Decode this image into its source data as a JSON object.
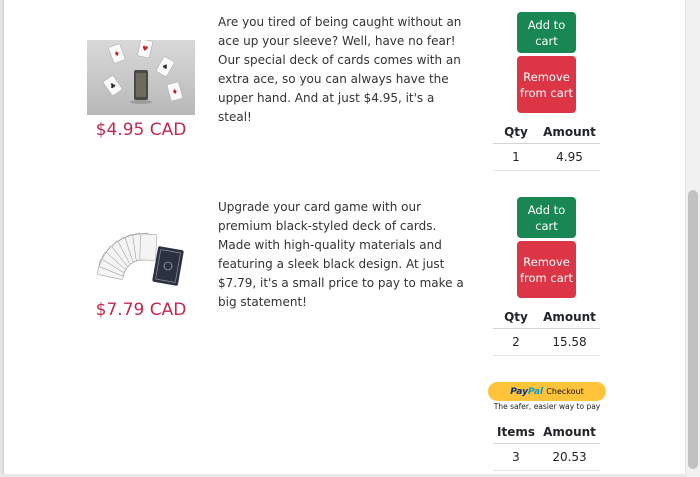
{
  "products": [
    {
      "description": "Are you tired of being caught without an ace up your sleeve? Well, have no fear! Our special deck of cards comes with an extra ace, so you can always have the upper hand. And at just $4.95, it's a steal!",
      "price": "$4.95 CAD",
      "add_label": "Add to cart",
      "remove_label": "Remove from cart",
      "qty_header": "Qty",
      "amount_header": "Amount",
      "qty": "1",
      "amount": "4.95"
    },
    {
      "description": "Upgrade your card game with our premium black-styled deck of cards. Made with high-quality materials and featuring a sleek black design. At just $7.79, it's a small price to pay to make a big statement!",
      "price": "$7.79 CAD",
      "add_label": "Add to cart",
      "remove_label": "Remove from cart",
      "qty_header": "Qty",
      "amount_header": "Amount",
      "qty": "2",
      "amount": "15.58"
    }
  ],
  "paypal": {
    "brand_pay": "Pay",
    "brand_pal": "Pal",
    "checkout_label": "Checkout",
    "tagline": "The safer, easier way to pay"
  },
  "summary": {
    "items_header": "Items",
    "amount_header": "Amount",
    "items": "3",
    "amount": "20.53"
  },
  "colors": {
    "price": "#c0294d",
    "add_button": "#198754",
    "remove_button": "#dc3545",
    "paypal_button": "#ffc439"
  }
}
